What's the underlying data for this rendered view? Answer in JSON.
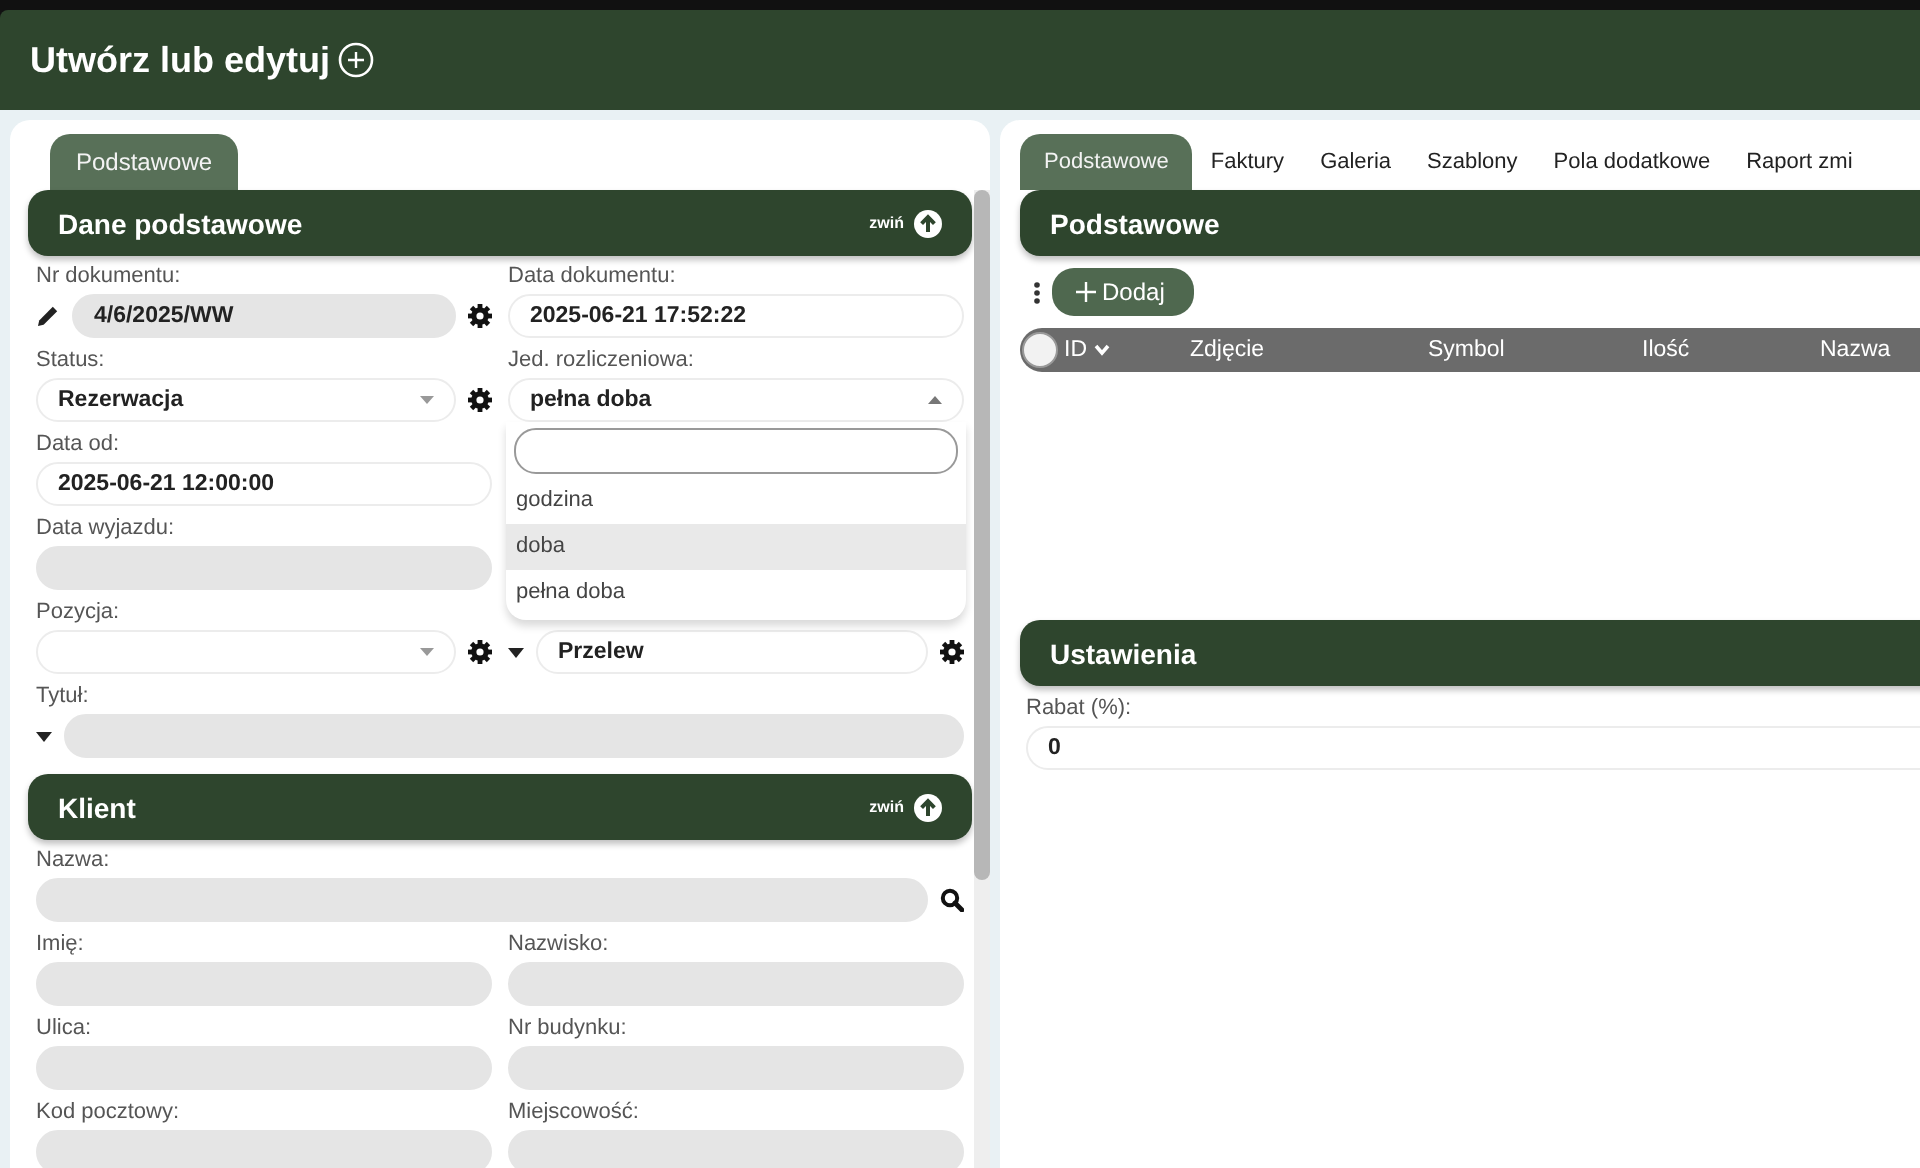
{
  "header": {
    "title": "Utwórz lub edytuj"
  },
  "left": {
    "tabs": [
      {
        "label": "Podstawowe",
        "selected": true
      }
    ],
    "sections": [
      {
        "title": "Dane podstawowe",
        "collapse": "zwiń",
        "rows": [
          [
            {
              "label": "Nr dokumentu:",
              "kind": "input",
              "value": "4/6/2025/WW",
              "disabled": true,
              "editable": true,
              "settings": true
            },
            {
              "label": "Data dokumentu:",
              "kind": "input",
              "value": "2025-06-21 17:52:22",
              "disabled": false
            }
          ],
          [
            {
              "label": "Status:",
              "kind": "select",
              "value": "Rezerwacja",
              "disabled": false,
              "settings": true,
              "open": false
            },
            {
              "label": "Jed. rozliczeniowa:",
              "kind": "select",
              "value": "pełna doba",
              "disabled": false,
              "open": true
            }
          ],
          [
            {
              "label": "Data od:",
              "kind": "input",
              "value": "2025-06-21 12:00:00",
              "disabled": false
            }
          ],
          [
            {
              "label": "Data wyjazdu:",
              "kind": "input",
              "disabled": true
            }
          ],
          [
            {
              "label": "Pozycja:",
              "kind": "select",
              "disabled": false,
              "settings": true,
              "open": false
            },
            {
              "kind": "input",
              "value": "Przelew",
              "disabled": false,
              "expandable": true,
              "settings": true
            }
          ],
          [
            {
              "label": "Tytuł:",
              "kind": "input",
              "disabled": true,
              "expandable": true,
              "wide": true
            }
          ]
        ],
        "dropdown": {
          "options": [
            {
              "label": "godzina",
              "highlighted": false
            },
            {
              "label": "doba",
              "highlighted": true
            },
            {
              "label": "pełna doba",
              "highlighted": false
            }
          ]
        }
      },
      {
        "title": "Klient",
        "collapse": "zwiń",
        "rows": [
          [
            {
              "label": "Nazwa:",
              "kind": "input",
              "disabled": true,
              "searchable": true,
              "wide": true
            }
          ],
          [
            {
              "label": "Imię:",
              "kind": "input",
              "disabled": true
            },
            {
              "label": "Nazwisko:",
              "kind": "input",
              "disabled": true
            }
          ],
          [
            {
              "label": "Ulica:",
              "kind": "input",
              "disabled": true
            },
            {
              "label": "Nr budynku:",
              "kind": "input",
              "disabled": true
            }
          ],
          [
            {
              "label": "Kod pocztowy:",
              "kind": "input",
              "disabled": true
            },
            {
              "label": "Miejscowość:",
              "kind": "input",
              "disabled": true
            }
          ]
        ]
      }
    ]
  },
  "right": {
    "tabs": [
      {
        "label": "Podstawowe",
        "selected": true
      },
      {
        "label": "Faktury",
        "selected": false
      },
      {
        "label": "Galeria",
        "selected": false
      },
      {
        "label": "Szablony",
        "selected": false
      },
      {
        "label": "Pola dodatkowe",
        "selected": false
      },
      {
        "label": "Raport zmi",
        "selected": false
      }
    ],
    "section": {
      "title": "Podstawowe",
      "add_button": "Dodaj",
      "all_checked": false,
      "columns": [
        {
          "label": "ID",
          "sortable": true
        },
        {
          "label": "Zdjęcie",
          "sortable": false
        },
        {
          "label": "Symbol",
          "sortable": false
        },
        {
          "label": "Ilość",
          "sortable": false
        },
        {
          "label": "Nazwa",
          "sortable": false
        }
      ]
    },
    "settings": {
      "title": "Ustawienia",
      "fields": [
        {
          "label": "Rabat (%):",
          "value": "0"
        }
      ]
    }
  }
}
